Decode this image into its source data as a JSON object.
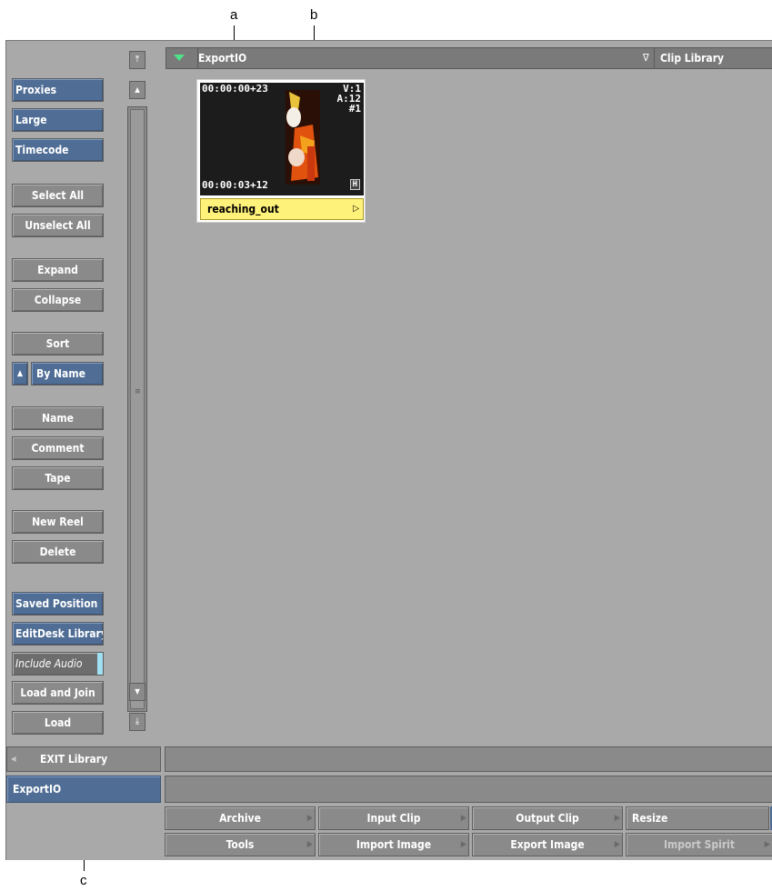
{
  "callouts": {
    "a": "a",
    "b": "b",
    "c": "c"
  },
  "header": {
    "title": "ExportIO",
    "library_label": "Clip Library",
    "library_glyph": "∇"
  },
  "sidebar": {
    "proxies": "Proxies",
    "large": "Large",
    "timecode": "Timecode",
    "select_all": "Select All",
    "unselect_all": "Unselect All",
    "expand": "Expand",
    "collapse": "Collapse",
    "sort": "Sort",
    "sort_dir_glyph": "▲",
    "by_name": "By Name",
    "name": "Name",
    "comment": "Comment",
    "tape": "Tape",
    "new_reel": "New Reel",
    "delete": "Delete",
    "saved_position": "Saved Position",
    "editdesk_library": "EditDesk Library",
    "include_audio": "Include Audio",
    "load_and_join": "Load and Join",
    "load": "Load"
  },
  "scroll": {
    "top": "⤒",
    "up": "▲",
    "down": "▼",
    "bottom": "⤓"
  },
  "clip": {
    "tc_start": "00:00:00+23",
    "tc_end": "00:00:03+12",
    "video": "V:1",
    "audio": "A:12",
    "number": "#1",
    "badge": "H",
    "name": "reaching_out",
    "arrow": "▷"
  },
  "footer": {
    "exit_library": "EXIT Library",
    "exit_glyph": "◀",
    "current_library": "ExportIO",
    "menu_row1": [
      "Archive",
      "Input Clip",
      "Output Clip",
      "Resize"
    ],
    "menu_row2": [
      "Tools",
      "Import Image",
      "Export Image",
      "Import Spirit"
    ],
    "menu_arrow": "▶"
  },
  "colors": {
    "panel": "#a9a9a9",
    "button": "#8a8a8a",
    "blue_button": "#4f6d95",
    "clip_label": "#fff27a",
    "accent_green": "#4fe38a"
  }
}
